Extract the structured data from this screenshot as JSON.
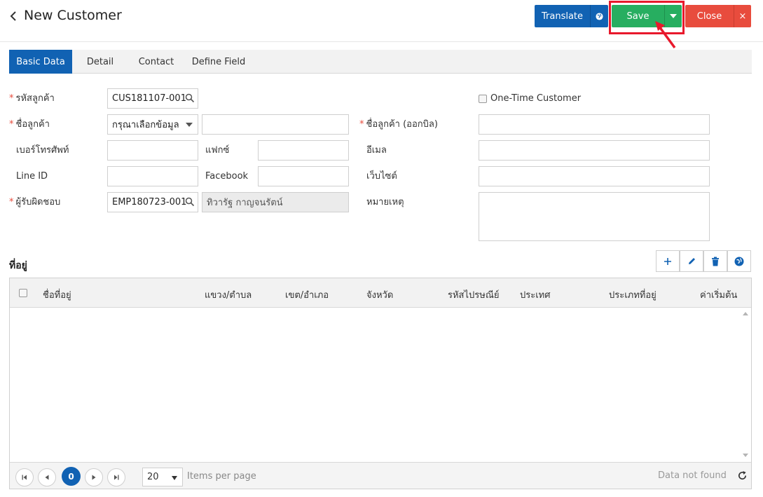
{
  "header": {
    "title": "New Customer",
    "translate_label": "Translate",
    "save_label": "Save",
    "close_label": "Close",
    "close_x": "×"
  },
  "tabs": [
    {
      "label": "Basic Data",
      "active": true
    },
    {
      "label": "Detail",
      "active": false
    },
    {
      "label": "Contact",
      "active": false
    },
    {
      "label": "Define Field",
      "active": false
    }
  ],
  "form": {
    "customer_code_label": "รหัสลูกค้า",
    "customer_code_value": "CUS181107-001",
    "one_time_label": "One-Time Customer",
    "customer_name_label": "ชื่อลูกค้า",
    "name_prefix_value": "กรุณาเลือกข้อมูล",
    "name_value": "",
    "bill_name_label": "ชื่อลูกค้า (ออกบิล)",
    "bill_name_value": "",
    "phone_label": "เบอร์โทรศัพท์",
    "phone_value": "",
    "fax_label": "แฟกซ์",
    "fax_value": "",
    "email_label": "อีเมล",
    "email_value": "",
    "line_label": "Line ID",
    "line_value": "",
    "facebook_label": "Facebook",
    "facebook_value": "",
    "website_label": "เว็บไซต์",
    "website_value": "",
    "owner_label": "ผู้รับผิดชอบ",
    "owner_code_value": "EMP180723-001",
    "owner_name_value": "ทิวารัฐ กาญจนรัตน์",
    "note_label": "หมายเหตุ",
    "note_value": ""
  },
  "address": {
    "title": "ที่อยู่",
    "columns": [
      "ชื่อที่อยู่",
      "แขวง/ตำบล",
      "เขต/อำเภอ",
      "จังหวัด",
      "รหัสไปรษณีย์",
      "ประเทศ",
      "ประเภทที่อยู่",
      "ค่าเริ่มต้น"
    ]
  },
  "pager": {
    "current_page": "0",
    "page_size": "20",
    "items_per_page_label": "Items per page",
    "status": "Data not found"
  },
  "colors": {
    "primary": "#1162b3",
    "save": "#27ae60",
    "close": "#e84c3d",
    "highlight": "#e8192c"
  },
  "icons": {
    "back": "chevron-left-icon",
    "globe": "globe-icon",
    "caret": "caret-down-icon",
    "search": "search-icon",
    "add": "plus-icon",
    "edit": "pencil-icon",
    "delete": "trash-icon",
    "map": "globe-icon",
    "refresh": "refresh-icon"
  }
}
